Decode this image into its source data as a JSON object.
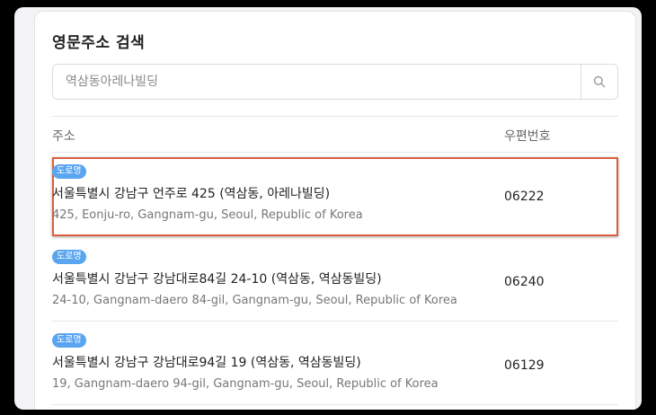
{
  "title": "영문주소 검색",
  "search": {
    "value": "",
    "placeholder": "역삼동아레나빌딩"
  },
  "columns": {
    "address": "주소",
    "zipcode": "우편번호"
  },
  "results": [
    {
      "badge": "도로명",
      "address_ko": "서울특별시 강남구 언주로 425 (역삼동, 아레나빌딩)",
      "address_en": "425, Eonju-ro, Gangnam-gu, Seoul, Republic of Korea",
      "zipcode": "06222",
      "selected": true
    },
    {
      "badge": "도로명",
      "address_ko": "서울특별시 강남구 강남대로84길 24-10 (역삼동, 역삼동빌딩)",
      "address_en": "24-10, Gangnam-daero 84-gil, Gangnam-gu, Seoul, Republic of Korea",
      "zipcode": "06240",
      "selected": false
    },
    {
      "badge": "도로명",
      "address_ko": "서울특별시 강남구 강남대로94길 19 (역삼동, 역삼동빌딩)",
      "address_en": "19, Gangnam-daero 94-gil, Gangnam-gu, Seoul, Republic of Korea",
      "zipcode": "06129",
      "selected": false
    }
  ],
  "colors": {
    "badge": "#5aa5f0",
    "selection_border": "#d9603f"
  },
  "icons": {
    "search_button": "search-icon"
  }
}
